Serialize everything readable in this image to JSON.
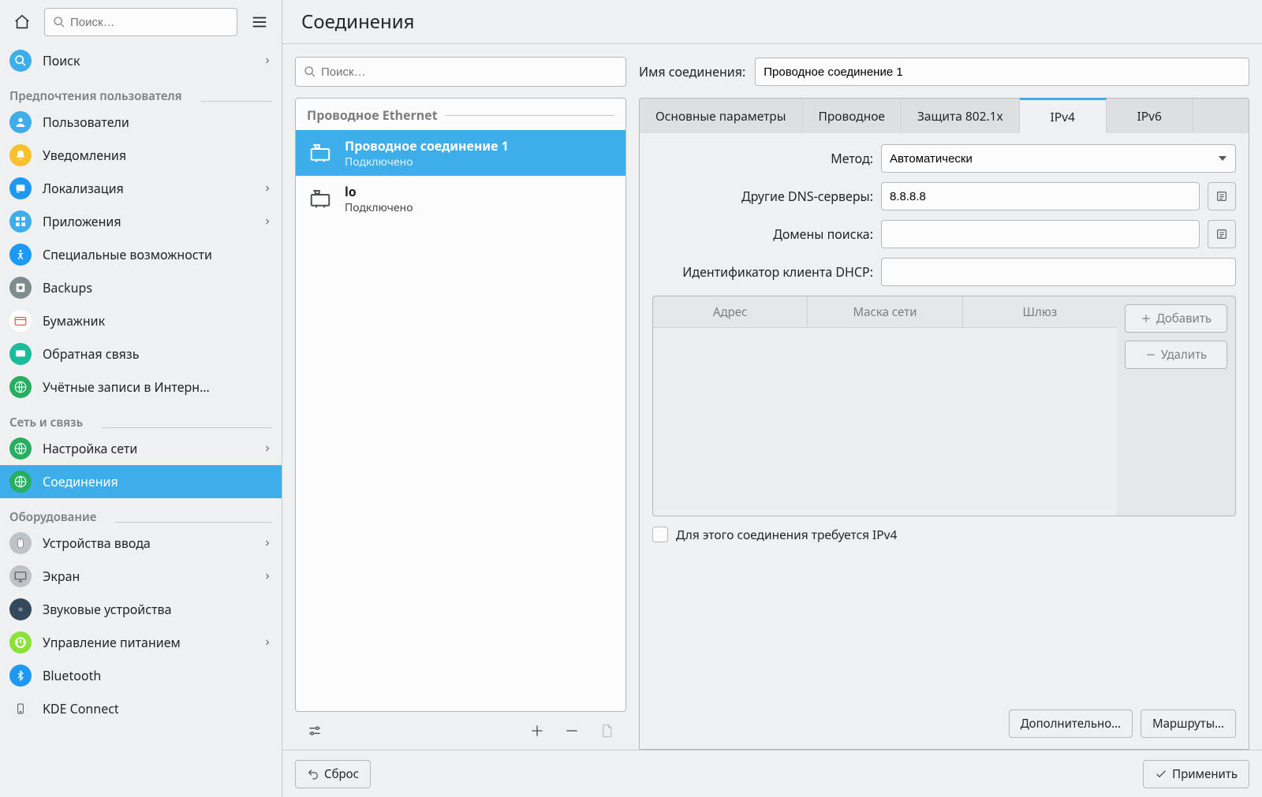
{
  "sidebar": {
    "search_placeholder": "Поиск…",
    "search_item_label": "Поиск",
    "categories": [
      {
        "title": "Предпочтения пользователя",
        "items": [
          {
            "label": "Пользователи",
            "icon": "users",
            "bg": "#3daee9"
          },
          {
            "label": "Уведомления",
            "icon": "bell",
            "bg": "#f9c22c"
          },
          {
            "label": "Локализация",
            "icon": "locale",
            "bg": "#1d99f3",
            "chev": true
          },
          {
            "label": "Приложения",
            "icon": "apps",
            "bg": "#3daee9",
            "chev": true
          },
          {
            "label": "Специальные возможности",
            "icon": "access",
            "bg": "#1d99f3"
          },
          {
            "label": "Backups",
            "icon": "backups",
            "bg": "#7f8c8d"
          },
          {
            "label": "Бумажник",
            "icon": "wallet",
            "bg": "#ffffff"
          },
          {
            "label": "Обратная связь",
            "icon": "feedback",
            "bg": "#1abc9c"
          },
          {
            "label": "Учётные записи в Интерн…",
            "icon": "globe",
            "bg": "#27ae60"
          }
        ]
      },
      {
        "title": "Сеть и связь",
        "items": [
          {
            "label": "Настройка сети",
            "icon": "globe",
            "bg": "#27ae60",
            "chev": true
          },
          {
            "label": "Соединения",
            "icon": "globe",
            "bg": "#27ae60",
            "selected": true
          }
        ]
      },
      {
        "title": "Оборудование",
        "items": [
          {
            "label": "Устройства ввода",
            "icon": "mouse",
            "bg": "#bdc3c7",
            "chev": true
          },
          {
            "label": "Экран",
            "icon": "display",
            "bg": "#bdc3c7",
            "chev": true
          },
          {
            "label": "Звуковые устройства",
            "icon": "sound",
            "bg": "#34495e"
          },
          {
            "label": "Управление питанием",
            "icon": "power",
            "bg": "#8ae234",
            "chev": true
          },
          {
            "label": "Bluetooth",
            "icon": "bt",
            "bg": "#1d99f3"
          },
          {
            "label": "KDE Connect",
            "icon": "kdec",
            "bg": "#ecf0f1"
          }
        ]
      }
    ]
  },
  "title": "Соединения",
  "conn_search_placeholder": "Поиск…",
  "conn_group": "Проводное Ethernet",
  "connections": [
    {
      "title": "Проводное соединение 1",
      "sub": "Подключено",
      "selected": true
    },
    {
      "title": "lo",
      "sub": "Подключено",
      "selected": false
    }
  ],
  "form": {
    "name_label": "Имя соединения:",
    "name_value": "Проводное соединение 1",
    "tabs": [
      "Основные параметры",
      "Проводное",
      "Защита 802.1x",
      "IPv4",
      "IPv6"
    ],
    "active_tab": 3,
    "method_label": "Метод:",
    "method_value": "Автоматически",
    "dns_label": "Другие DNS-серверы:",
    "dns_value": "8.8.8.8",
    "domains_label": "Домены поиска:",
    "domains_value": "",
    "dhcp_label": "Идентификатор клиента DHCP:",
    "dhcp_value": "",
    "addr_cols": [
      "Адрес",
      "Маска сети",
      "Шлюз"
    ],
    "add_btn": "Добавить",
    "del_btn": "Удалить",
    "ipv4_chk": "Для этого соединения требуется IPv4",
    "advanced_btn": "Дополнительно…",
    "routes_btn": "Маршруты…"
  },
  "bottom": {
    "reset": "Сброс",
    "apply": "Применить"
  }
}
